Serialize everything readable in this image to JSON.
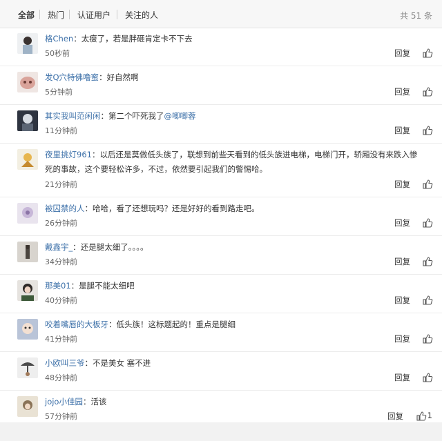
{
  "tabs": [
    {
      "label": "全部"
    },
    {
      "label": "热门"
    },
    {
      "label": "认证用户"
    },
    {
      "label": "关注的人"
    }
  ],
  "comment_count": "共 51 条",
  "reply_label": "回复",
  "comments": [
    {
      "user": "格Chen",
      "text": "太瘦了，若是胖砸肯定卡不下去",
      "time": "50秒前"
    },
    {
      "user": "发Q穴特佛噜蜜",
      "text": "好自然啊",
      "time": "5分钟前"
    },
    {
      "user": "其实我叫范闲闲",
      "text": "第二个吓死我了",
      "mention": "@唧唧蓉",
      "time": "11分钟前"
    },
    {
      "user": "夜里挑灯961",
      "text": "以后还是莫做低头族了，联想到前些天看到的低头族进电梯，电梯门开，轿厢没有来跌入惨",
      "text2": "死的事故，这个要轻松许多，不过，依然要引起我们的警惕哈。",
      "time": "21分钟前"
    },
    {
      "user": "被囚禁的人",
      "text": "哈哈，看了还想玩吗？还是好好的看到路走吧。",
      "time": "26分钟前"
    },
    {
      "user": "戴鑫宇_",
      "text": "还是腿太细了。。。。",
      "time": "34分钟前"
    },
    {
      "user": "那美01",
      "text": "是腿不能太细吧",
      "time": "40分钟前"
    },
    {
      "user": "咬着嘴唇的大板牙",
      "text": "低头族！这标题起的！重点是腿细",
      "time": "41分钟前"
    },
    {
      "user": "小欧叫三爷",
      "text": "不是美女 塞不进",
      "time": "48分钟前"
    },
    {
      "user": "jojo小佳园",
      "text": "活该",
      "time": "57分钟前",
      "likes": "1"
    }
  ],
  "colors": {
    "link": "#3b6fa8",
    "tab_bg": "#f7f7f7",
    "divider": "#ececec"
  }
}
